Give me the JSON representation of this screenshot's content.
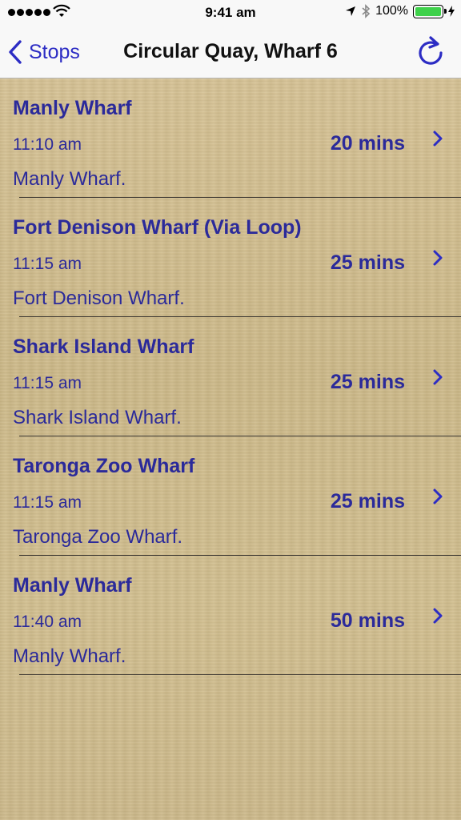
{
  "status_bar": {
    "time": "9:41 am",
    "battery": "100%"
  },
  "nav": {
    "back_label": "Stops",
    "title": "Circular Quay, Wharf 6"
  },
  "departures": [
    {
      "destination": "Manly Wharf",
      "time": "11:10 am",
      "mins": "20 mins",
      "subtitle": "Manly Wharf."
    },
    {
      "destination": "Fort Denison Wharf (Via Loop)",
      "time": "11:15 am",
      "mins": "25 mins",
      "subtitle": "Fort Denison Wharf."
    },
    {
      "destination": "Shark Island Wharf",
      "time": "11:15 am",
      "mins": "25 mins",
      "subtitle": "Shark Island Wharf."
    },
    {
      "destination": "Taronga Zoo Wharf",
      "time": "11:15 am",
      "mins": "25 mins",
      "subtitle": "Taronga Zoo Wharf."
    },
    {
      "destination": "Manly Wharf",
      "time": "11:40 am",
      "mins": "50 mins",
      "subtitle": "Manly Wharf."
    }
  ],
  "colors": {
    "accent": "#2c2cc4",
    "row_text": "#2b2a9a",
    "background": "#d4c195"
  },
  "icons": [
    "signal-dots-icon",
    "wifi-icon",
    "location-arrow-icon",
    "bluetooth-icon",
    "battery-icon",
    "charging-bolt-icon",
    "back-chevron-icon",
    "refresh-icon",
    "chevron-right-icon"
  ]
}
